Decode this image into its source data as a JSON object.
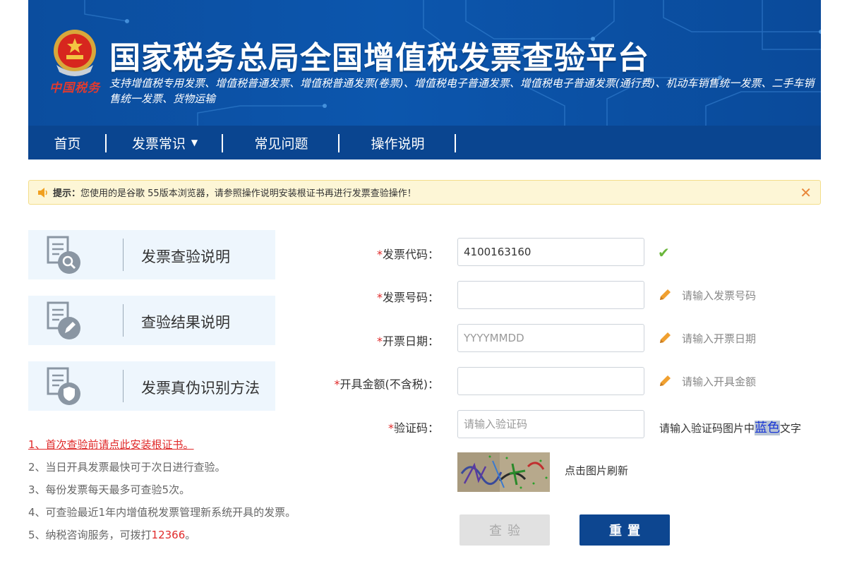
{
  "header": {
    "title": "国家税务总局全国增值税发票查验平台",
    "subtitle": "支持增值税专用发票、增值税普通发票、增值税普通发票(卷票)、增值税电子普通发票、增值税电子普通发票(通行费)、机动车销售统一发票、二手车销售统一发票、货物运输",
    "seal_text": "中国税务"
  },
  "nav": {
    "items": [
      {
        "label": "首页"
      },
      {
        "label": "发票常识"
      },
      {
        "label": "常见问题"
      },
      {
        "label": "操作说明"
      }
    ]
  },
  "notice": {
    "label": "提示：",
    "text": "您使用的是谷歌 55版本浏览器，请参照操作说明安装根证书再进行发票查验操作！",
    "close": "✕"
  },
  "cards": [
    {
      "label": "发票查验说明",
      "icon": "document-search-icon"
    },
    {
      "label": "查验结果说明",
      "icon": "document-edit-icon"
    },
    {
      "label": "发票真伪识别方法",
      "icon": "document-shield-icon"
    }
  ],
  "notes": {
    "n1": "1、首次查验前请点此安装根证书。",
    "n2": "2、当日开具发票最快可于次日进行查验。",
    "n3": "3、每份发票每天最多可查验5次。",
    "n4": "4、可查验最近1年内增值税发票管理新系统开具的发票。",
    "n5_prefix": "5、纳税咨询服务，可拨打",
    "n5_phone": "12366",
    "n5_suffix": "。"
  },
  "form": {
    "required_mark": "*",
    "code_label": "发票代码：",
    "code_value": "4100163160",
    "code_status": "✔",
    "number_label": "发票号码：",
    "number_value": "",
    "number_hint": "请输入发票号码",
    "date_label": "开票日期：",
    "date_placeholder": "YYYYMMDD",
    "date_hint": "请输入开票日期",
    "amount_label": "开具金额(不含税)：",
    "amount_value": "",
    "amount_hint": "请输入开具金额",
    "captcha_label": "验证码：",
    "captcha_placeholder": "请输入验证码",
    "captcha_hint_prefix": "请输入验证码图片中",
    "captcha_hint_color": "蓝色",
    "captcha_hint_suffix": "文字",
    "refresh_text": "点击图片刷新"
  },
  "buttons": {
    "check": "查验",
    "reset": "重置"
  },
  "colors": {
    "banner": "#0c56ad",
    "nav": "#0a4590",
    "required": "#e02a2a",
    "reset_button": "#0d4690"
  }
}
